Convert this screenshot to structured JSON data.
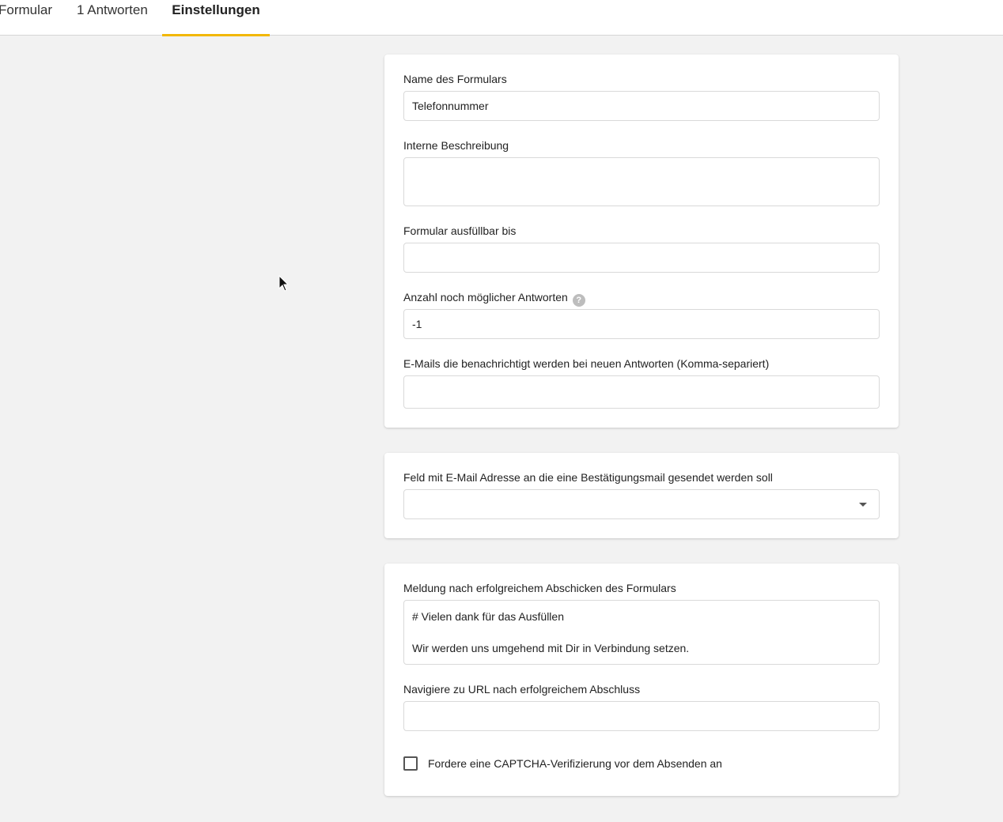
{
  "tabs": [
    {
      "label": "Formular"
    },
    {
      "label": "1 Antworten"
    },
    {
      "label": "Einstellungen",
      "active": true
    }
  ],
  "accent_color": "#f2b705",
  "general": {
    "form_name_label": "Name des Formulars",
    "form_name_value": "Telefonnummer",
    "internal_description_label": "Interne Beschreibung",
    "internal_description_value": "",
    "fillable_until_label": "Formular ausfüllbar bis",
    "fillable_until_value": "",
    "remaining_answers_label": "Anzahl noch möglicher Antworten",
    "remaining_answers_help": "?",
    "remaining_answers_value": "-1",
    "notify_emails_label": "E-Mails die benachrichtigt werden bei neuen Antworten (Komma-separiert)",
    "notify_emails_value": ""
  },
  "confirmation": {
    "email_field_label": "Feld mit E-Mail Adresse an die eine Bestätigungsmail gesendet werden soll",
    "email_field_selected": ""
  },
  "completion": {
    "success_message_label": "Meldung nach erfolgreichem Abschicken des Formulars",
    "success_message_lines": [
      "# Vielen dank für das Ausfüllen",
      "",
      "Wir werden uns umgehend mit Dir in Verbindung setzen."
    ],
    "redirect_url_label": "Navigiere zu URL nach erfolgreichem Abschluss",
    "redirect_url_value": "",
    "captcha_label": "Fordere eine CAPTCHA-Verifizierung vor dem Absenden an",
    "captcha_checked": false
  }
}
